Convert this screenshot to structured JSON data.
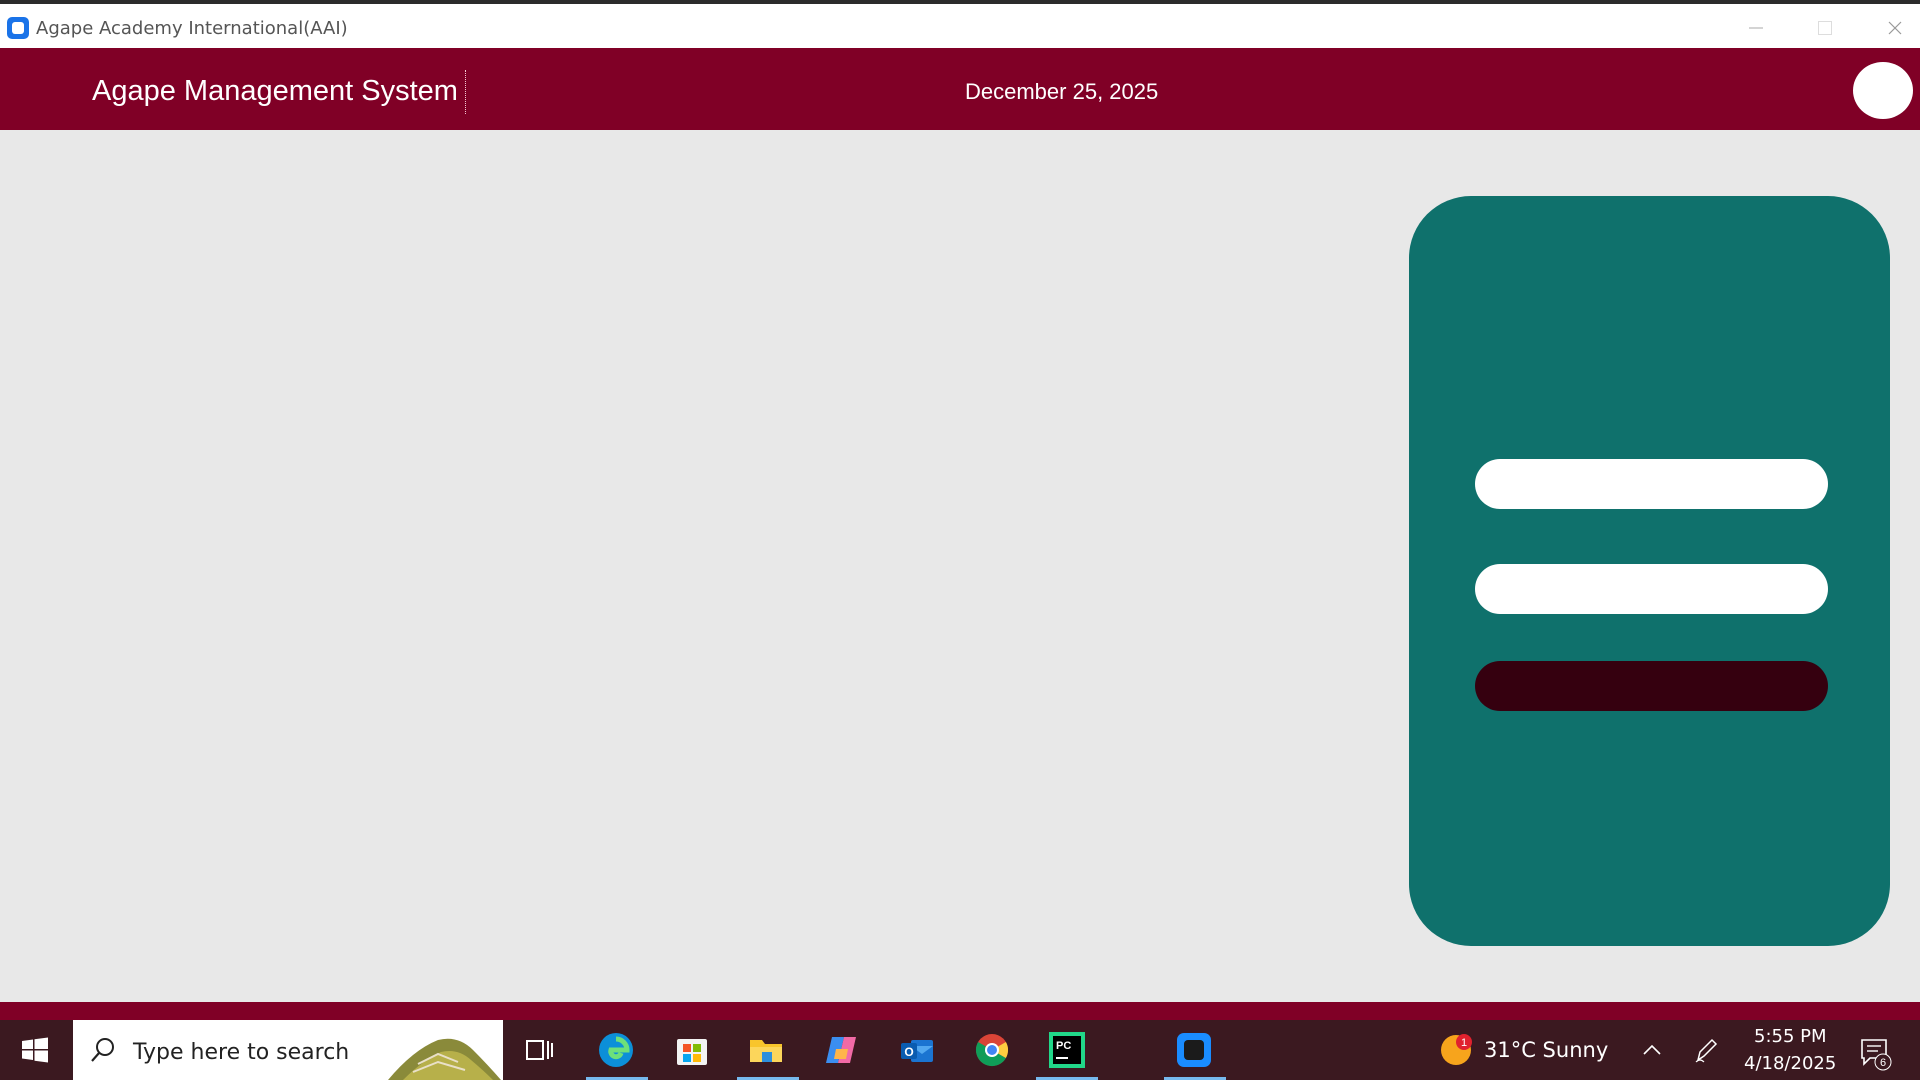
{
  "window": {
    "title": "Agape Academy International(AAI)",
    "icon": "app-icon"
  },
  "header": {
    "brand": "Agape Management System",
    "date": "December 25, 2025",
    "avatar_icon": "user-avatar"
  },
  "login_card": {
    "username_value": "",
    "password_value": "",
    "submit_label": ""
  },
  "colors": {
    "header_bg": "#800026",
    "card_bg": "#0f716c",
    "button_bg": "#35000f",
    "page_bg": "#e8e8e8"
  },
  "taskbar": {
    "search_placeholder": "Type here to search",
    "apps": [
      "task-view-icon",
      "edge-icon",
      "store-icon",
      "file-explorer-icon",
      "copilot-icon",
      "outlook-icon",
      "chrome-icon",
      "pycharm-icon",
      "app-window-icon"
    ],
    "weather": {
      "badge": "1",
      "text": "31°C  Sunny"
    },
    "clock": {
      "time": "5:55 PM",
      "date": "4/18/2025"
    },
    "notifications_count": "6"
  }
}
